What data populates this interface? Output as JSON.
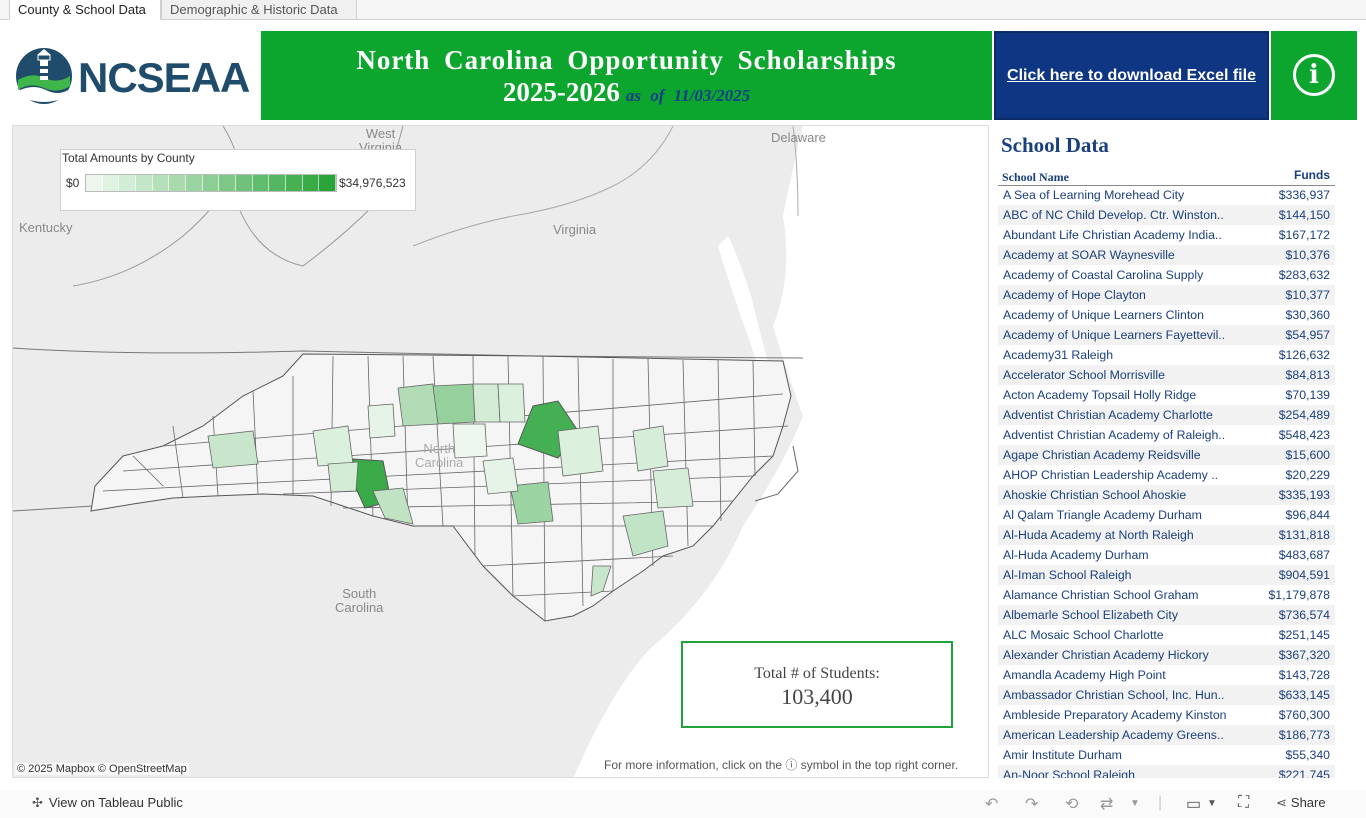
{
  "tabs": [
    {
      "label": "County & School Data",
      "active": true
    },
    {
      "label": "Demographic & Historic Data",
      "active": false
    }
  ],
  "header": {
    "logo_text": "NCSEAA",
    "title_line1": "North Carolina Opportunity Scholarships",
    "title_line2": "2025-2026",
    "as_of": "as of 11/03/2025",
    "download_label": "Click here to download Excel file",
    "info_icon": "info-circle-icon",
    "colors": {
      "banner_green": "#0ca62e",
      "banner_blue": "#0f3682"
    }
  },
  "map": {
    "place_labels": {
      "west_virginia": "West\nVirginia",
      "delaware": "Delaware",
      "kentucky": "Kentucky",
      "virginia": "Virginia",
      "north_carolina": "North\nCarolina",
      "south_carolina": "South\nCarolina"
    },
    "legend": {
      "title": "Total Amounts by County",
      "min": "$0",
      "max": "$34,976,523",
      "ramp_colors": [
        "#eef7ee",
        "#e0f2e2",
        "#d2ecd5",
        "#c4e6c8",
        "#b6e0bb",
        "#a8daae",
        "#9ad4a1",
        "#8cce94",
        "#7ec887",
        "#70c27a",
        "#62bc6d",
        "#54b660",
        "#46b053",
        "#38aa46",
        "#2aa439"
      ]
    },
    "students": {
      "label": "Total # of Students:",
      "value": "103,400"
    },
    "attribution": "© 2025 Mapbox  © OpenStreetMap",
    "more_info": "For more information, click on the ⓘ symbol in the top right corner."
  },
  "school_data": {
    "title": "School Data",
    "col_name": "School Name",
    "col_funds": "Funds",
    "rows": [
      {
        "name": "A Sea of Learning Morehead City",
        "funds": "$336,937"
      },
      {
        "name": "ABC of NC Child Develop. Ctr. Winston..",
        "funds": "$144,150"
      },
      {
        "name": "Abundant Life Christian Academy India..",
        "funds": "$167,172"
      },
      {
        "name": "Academy at SOAR Waynesville",
        "funds": "$10,376"
      },
      {
        "name": "Academy of Coastal Carolina Supply",
        "funds": "$283,632"
      },
      {
        "name": "Academy of Hope Clayton",
        "funds": "$10,377"
      },
      {
        "name": "Academy of Unique Learners Clinton",
        "funds": "$30,360"
      },
      {
        "name": "Academy of Unique Learners Fayettevil..",
        "funds": "$54,957"
      },
      {
        "name": "Academy31 Raleigh",
        "funds": "$126,632"
      },
      {
        "name": "Accelerator School Morrisville",
        "funds": "$84,813"
      },
      {
        "name": "Acton Academy Topsail Holly Ridge",
        "funds": "$70,139"
      },
      {
        "name": "Adventist Christian Academy Charlotte",
        "funds": "$254,489"
      },
      {
        "name": "Adventist Christian Academy of Raleigh..",
        "funds": "$548,423"
      },
      {
        "name": "Agape Christian Academy Reidsville",
        "funds": "$15,600"
      },
      {
        "name": "AHOP Christian Leadership Academy ..",
        "funds": "$20,229"
      },
      {
        "name": "Ahoskie Christian School Ahoskie",
        "funds": "$335,193"
      },
      {
        "name": "Al Qalam Triangle Academy Durham",
        "funds": "$96,844"
      },
      {
        "name": "Al-Huda Academy at North Raleigh",
        "funds": "$131,818"
      },
      {
        "name": "Al-Huda Academy Durham",
        "funds": "$483,687"
      },
      {
        "name": "Al-Iman School Raleigh",
        "funds": "$904,591"
      },
      {
        "name": "Alamance Christian School Graham",
        "funds": "$1,179,878"
      },
      {
        "name": "Albemarle School Elizabeth City",
        "funds": "$736,574"
      },
      {
        "name": "ALC Mosaic School Charlotte",
        "funds": "$251,145"
      },
      {
        "name": "Alexander Christian Academy Hickory",
        "funds": "$367,320"
      },
      {
        "name": "Amandla Academy High Point",
        "funds": "$143,728"
      },
      {
        "name": "Ambassador Christian School, Inc. Hun..",
        "funds": "$633,145"
      },
      {
        "name": "Ambleside Preparatory Academy Kinston",
        "funds": "$760,300"
      },
      {
        "name": "American Leadership Academy Greens..",
        "funds": "$186,773"
      },
      {
        "name": "Amir Institute Durham",
        "funds": "$55,340"
      },
      {
        "name": "An-Noor School Raleigh",
        "funds": "$221,745"
      }
    ]
  },
  "toolbar": {
    "view_label": "View on Tableau Public",
    "share_label": "Share",
    "icons": [
      "undo-icon",
      "redo-icon",
      "revert-icon",
      "refresh-icon",
      "pause-icon",
      "comment-icon",
      "fullscreen-icon",
      "share-icon"
    ]
  }
}
